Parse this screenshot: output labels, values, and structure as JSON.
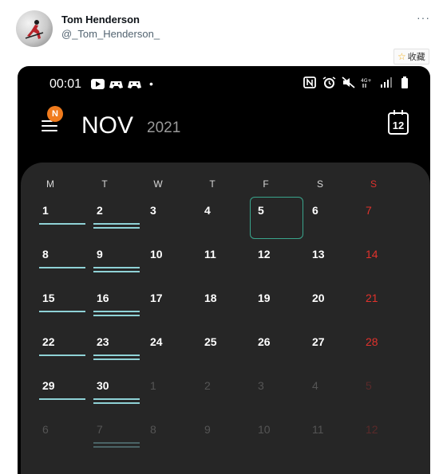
{
  "post": {
    "name": "Tom Henderson",
    "handle": "@_Tom_Henderson_",
    "more": "···",
    "favorite_label": "收藏"
  },
  "phone": {
    "status": {
      "time": "00:01",
      "dot": "•",
      "icons_left": [
        "youtube-icon",
        "game-controller-icon",
        "game-controller-icon"
      ],
      "icons_right": [
        "nfc-icon",
        "alarm-icon",
        "mute-icon",
        "4g-signal-icon",
        "signal-icon",
        "battery-icon"
      ]
    },
    "header": {
      "badge": "N",
      "month": "NOV",
      "year": "2021",
      "today_day": "12"
    },
    "weekdays": [
      "M",
      "T",
      "W",
      "T",
      "F",
      "S",
      "S"
    ],
    "weeks": [
      [
        "1",
        "2",
        "3",
        "4",
        "5",
        "6",
        "7"
      ],
      [
        "8",
        "9",
        "10",
        "11",
        "12",
        "13",
        "14"
      ],
      [
        "15",
        "16",
        "17",
        "18",
        "19",
        "20",
        "21"
      ],
      [
        "22",
        "23",
        "24",
        "25",
        "26",
        "27",
        "28"
      ],
      [
        "29",
        "30",
        "1",
        "2",
        "3",
        "4",
        "5"
      ],
      [
        "6",
        "7",
        "8",
        "9",
        "10",
        "11",
        "12"
      ]
    ],
    "colors": {
      "accent_bar": "#8fd2d6",
      "today_border": "#3aa58c",
      "sunday": "#e0322c",
      "badge": "#f07b1d",
      "panel": "#262626"
    }
  }
}
